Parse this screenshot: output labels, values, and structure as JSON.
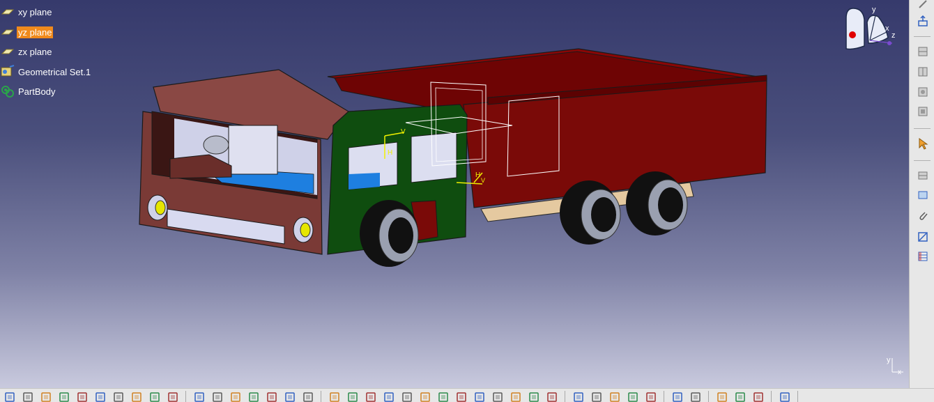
{
  "spec_tree": {
    "items": [
      {
        "label": "xy plane",
        "icon": "plane-icon",
        "selected": false
      },
      {
        "label": "yz plane",
        "icon": "plane-icon",
        "selected": true
      },
      {
        "label": "zx plane",
        "icon": "plane-icon",
        "selected": false
      },
      {
        "label": "Geometrical Set.1",
        "icon": "geometrical-set-icon",
        "selected": false
      },
      {
        "label": "PartBody",
        "icon": "partbody-icon",
        "selected": false
      }
    ]
  },
  "compass": {
    "axis_x": "x",
    "axis_y": "y",
    "axis_z": "z"
  },
  "sketch_axes": {
    "v1": "V",
    "h1": "H",
    "v2": "V",
    "h2": "H"
  },
  "axis_corner": {
    "y": "y",
    "x": "x"
  },
  "colors": {
    "selection": "#f08a1c",
    "cab": "#7a3a36",
    "door": "#0f4d0f",
    "cargo": "#7a0a08",
    "floor": "#1e7fe0"
  },
  "right_toolbar": [
    {
      "icon": "pin-icon"
    },
    {
      "icon": "export-icon"
    },
    {
      "icon": "stack-icon-1"
    },
    {
      "icon": "stack-icon-2"
    },
    {
      "icon": "stack-icon-3"
    },
    {
      "icon": "stack-icon-4"
    },
    {
      "icon": "select-arrow-icon"
    },
    {
      "icon": "assembly-icon-1"
    },
    {
      "icon": "assembly-icon-2"
    },
    {
      "icon": "paperclip-icon"
    },
    {
      "icon": "measure-icon"
    },
    {
      "icon": "table-icon"
    }
  ],
  "bottom_toolbar": [
    "open-icon",
    "folder-icon",
    "save-icon",
    "print-icon",
    "cut-icon",
    "copy-icon",
    "paste-icon",
    "undo-icon",
    "redo-icon",
    "help-icon",
    "formula-icon",
    "knowledge-icon",
    "pin-icon",
    "table-icon",
    "tree-icon",
    "user-icon",
    "sketch-icon",
    "fly-icon",
    "fit-all-icon",
    "pan-icon",
    "rotate-icon",
    "zoom-in-icon",
    "zoom-out-icon",
    "normal-view-icon",
    "view-cube-icon",
    "iso-view-icon",
    "shading-icon",
    "hide-show-icon",
    "swap-icon",
    "render-icon",
    "axis-icon",
    "list-icon",
    "grid-icon",
    "grid2-icon",
    "grid3-icon",
    "arrows-icon",
    "part-icon",
    "chart-icon",
    "layer-icon",
    "layer2-icon",
    "catia-logo-icon"
  ]
}
